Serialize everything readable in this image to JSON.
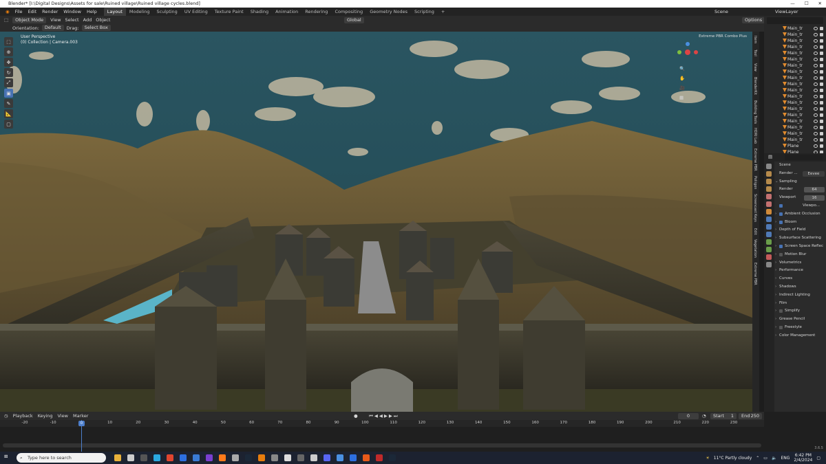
{
  "window": {
    "title": "Blender* [I:\\Digital Designs\\Assets for sale\\Ruined village\\Ruined village cycles.blend]"
  },
  "menu": [
    "File",
    "Edit",
    "Render",
    "Window",
    "Help"
  ],
  "workspaces": [
    "Layout",
    "Modeling",
    "Sculpting",
    "UV Editing",
    "Texture Paint",
    "Shading",
    "Animation",
    "Rendering",
    "Compositing",
    "Geometry Nodes",
    "Scripting"
  ],
  "scene_name": "Scene",
  "view_layer": "ViewLayer",
  "viewport_header": {
    "mode": "Object Mode",
    "menus": [
      "View",
      "Select",
      "Add",
      "Object"
    ],
    "transform": "Global",
    "options": "Options"
  },
  "tool_settings": {
    "orientation_label": "Orientation:",
    "orientation": "Default",
    "drag_label": "Drag:",
    "drag": "Select Box"
  },
  "viewport": {
    "perspective": "User Perspective",
    "collection": "(0) Collection | Camera.003",
    "addon_label": "Extreme PBR Combo Plus"
  },
  "npanel_tabs": [
    "Item",
    "Tool",
    "View",
    "BlenderKit",
    "Building Tools",
    "HDRI Lab",
    "Extreme PBR",
    "Poliigon",
    "Screencast Keys",
    "Edit",
    "Vegetation",
    "Extreme PBR"
  ],
  "outliner": {
    "items": [
      "Main_tr",
      "Main_tr",
      "Main_tr",
      "Main_tr",
      "Main_tr",
      "Main_tr",
      "Main_tr",
      "Main_tr",
      "Main_tr",
      "Main_tr",
      "Main_tr",
      "Main_tr",
      "Main_tr",
      "Main_tr",
      "Main_tr",
      "Main_tr",
      "Main_tr",
      "Main_tr",
      "Main_tr",
      "Plane",
      "Plane"
    ]
  },
  "properties": {
    "scene": "Scene",
    "render_label": "Render ...",
    "engine": "Eevee",
    "sampling": "Sampling",
    "render_samples_label": "Render",
    "render_samples": "64",
    "viewport_samples_label": "Viewport",
    "viewport_samples": "16",
    "viewport_denoise": "Viewpo...",
    "panels": [
      {
        "label": "Ambient Occlusion",
        "checkbox": true,
        "on": true
      },
      {
        "label": "Bloom",
        "checkbox": true,
        "on": true
      },
      {
        "label": "Depth of Field",
        "checkbox": false,
        "on": false
      },
      {
        "label": "Subsurface Scattering",
        "checkbox": false,
        "on": false
      },
      {
        "label": "Screen Space Reflec",
        "checkbox": true,
        "on": true
      },
      {
        "label": "Motion Blur",
        "checkbox": true,
        "on": false
      },
      {
        "label": "Volumetrics",
        "checkbox": false,
        "on": false
      },
      {
        "label": "Performance",
        "checkbox": false,
        "on": false
      },
      {
        "label": "Curves",
        "checkbox": false,
        "on": false
      },
      {
        "label": "Shadows",
        "checkbox": false,
        "on": false
      },
      {
        "label": "Indirect Lighting",
        "checkbox": false,
        "on": false
      },
      {
        "label": "Film",
        "checkbox": false,
        "on": false
      },
      {
        "label": "Simplify",
        "checkbox": true,
        "on": false
      },
      {
        "label": "Grease Pencil",
        "checkbox": false,
        "on": false
      },
      {
        "label": "Freestyle",
        "checkbox": true,
        "on": false
      },
      {
        "label": "Color Management",
        "checkbox": false,
        "on": false
      }
    ]
  },
  "timeline": {
    "menus": [
      "Playback",
      "Keying",
      "View",
      "Marker"
    ],
    "current_frame": "0",
    "start_label": "Start",
    "start": "1",
    "end_label": "End",
    "end": "250",
    "ticks": [
      "-20",
      "-10",
      "0",
      "10",
      "20",
      "30",
      "40",
      "50",
      "60",
      "70",
      "80",
      "90",
      "100",
      "110",
      "120",
      "130",
      "140",
      "150",
      "160",
      "170",
      "180",
      "190",
      "200",
      "210",
      "220",
      "230"
    ],
    "version": "3.6.5"
  },
  "taskbar": {
    "search_placeholder": "Type here to search",
    "weather": "11°C  Partly cloudy",
    "lang": "ENG",
    "time": "6:42 PM",
    "date": "2/4/2024"
  }
}
